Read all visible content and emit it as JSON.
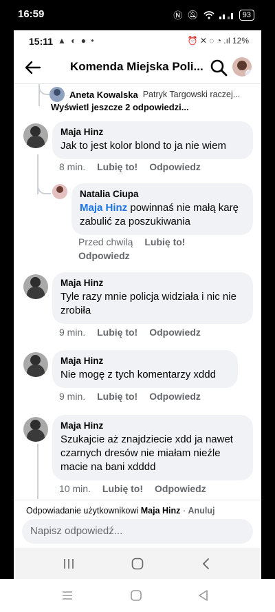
{
  "outer_status": {
    "time": "16:59",
    "icons": [
      "nfc-icon",
      "mute-icon",
      "wifi-icon",
      "signal-icon"
    ],
    "battery": "93"
  },
  "inner_status": {
    "time": "15:11",
    "left_icons": "▲ ◐ ● •",
    "right_text": "⏰ ✕ ◌ ◔ .ıl 12%"
  },
  "header": {
    "title": "Komenda Miejska Poli..."
  },
  "thread": {
    "preview": {
      "name": "Aneta Kowalska",
      "text": "Patryk Targowski raczej..."
    },
    "more_replies": "Wyświetl jeszcze 2 odpowiedzi...",
    "comments": [
      {
        "name": "Maja Hinz",
        "text": "Jak to jest kolor blond to ja nie wiem",
        "time": "8 min.",
        "like": "Lubię to!",
        "reply": "Odpowiedz"
      },
      {
        "name": "Natalia Ciupa",
        "mention": "Maja Hinz",
        "text": " powinnaś nie małą karę zabulić za poszukiwania",
        "time": "Przed chwilą",
        "like": "Lubię to!",
        "reply": "Odpowiedz"
      },
      {
        "name": "Maja Hinz",
        "text": "Tyle razy mnie policja widziała i nic nie zrobiła",
        "time": "9 min.",
        "like": "Lubię to!",
        "reply": "Odpowiedz"
      },
      {
        "name": "Maja Hinz",
        "text": "Nie mogę z tych komentarzy xddd",
        "time": "9 min.",
        "like": "Lubię to!",
        "reply": "Odpowiedz"
      },
      {
        "name": "Maja Hinz",
        "text": "Szukajcie aż znajdziecie xdd ja nawet czarnych dresów nie miałam nieźle macie na bani xdddd",
        "time": "10 min.",
        "like": "Lubię to!",
        "reply": "Odpowiedz"
      }
    ]
  },
  "composer": {
    "replying_prefix": "Odpowiadanie użytkownikowi ",
    "replying_to": "Maja Hinz",
    "separator": " · ",
    "cancel": "Anuluj",
    "placeholder": "Napisz odpowiedź..."
  },
  "colors": {
    "bubble": "#f0f2f5",
    "mention": "#1b74e4",
    "meta": "#65676b"
  }
}
